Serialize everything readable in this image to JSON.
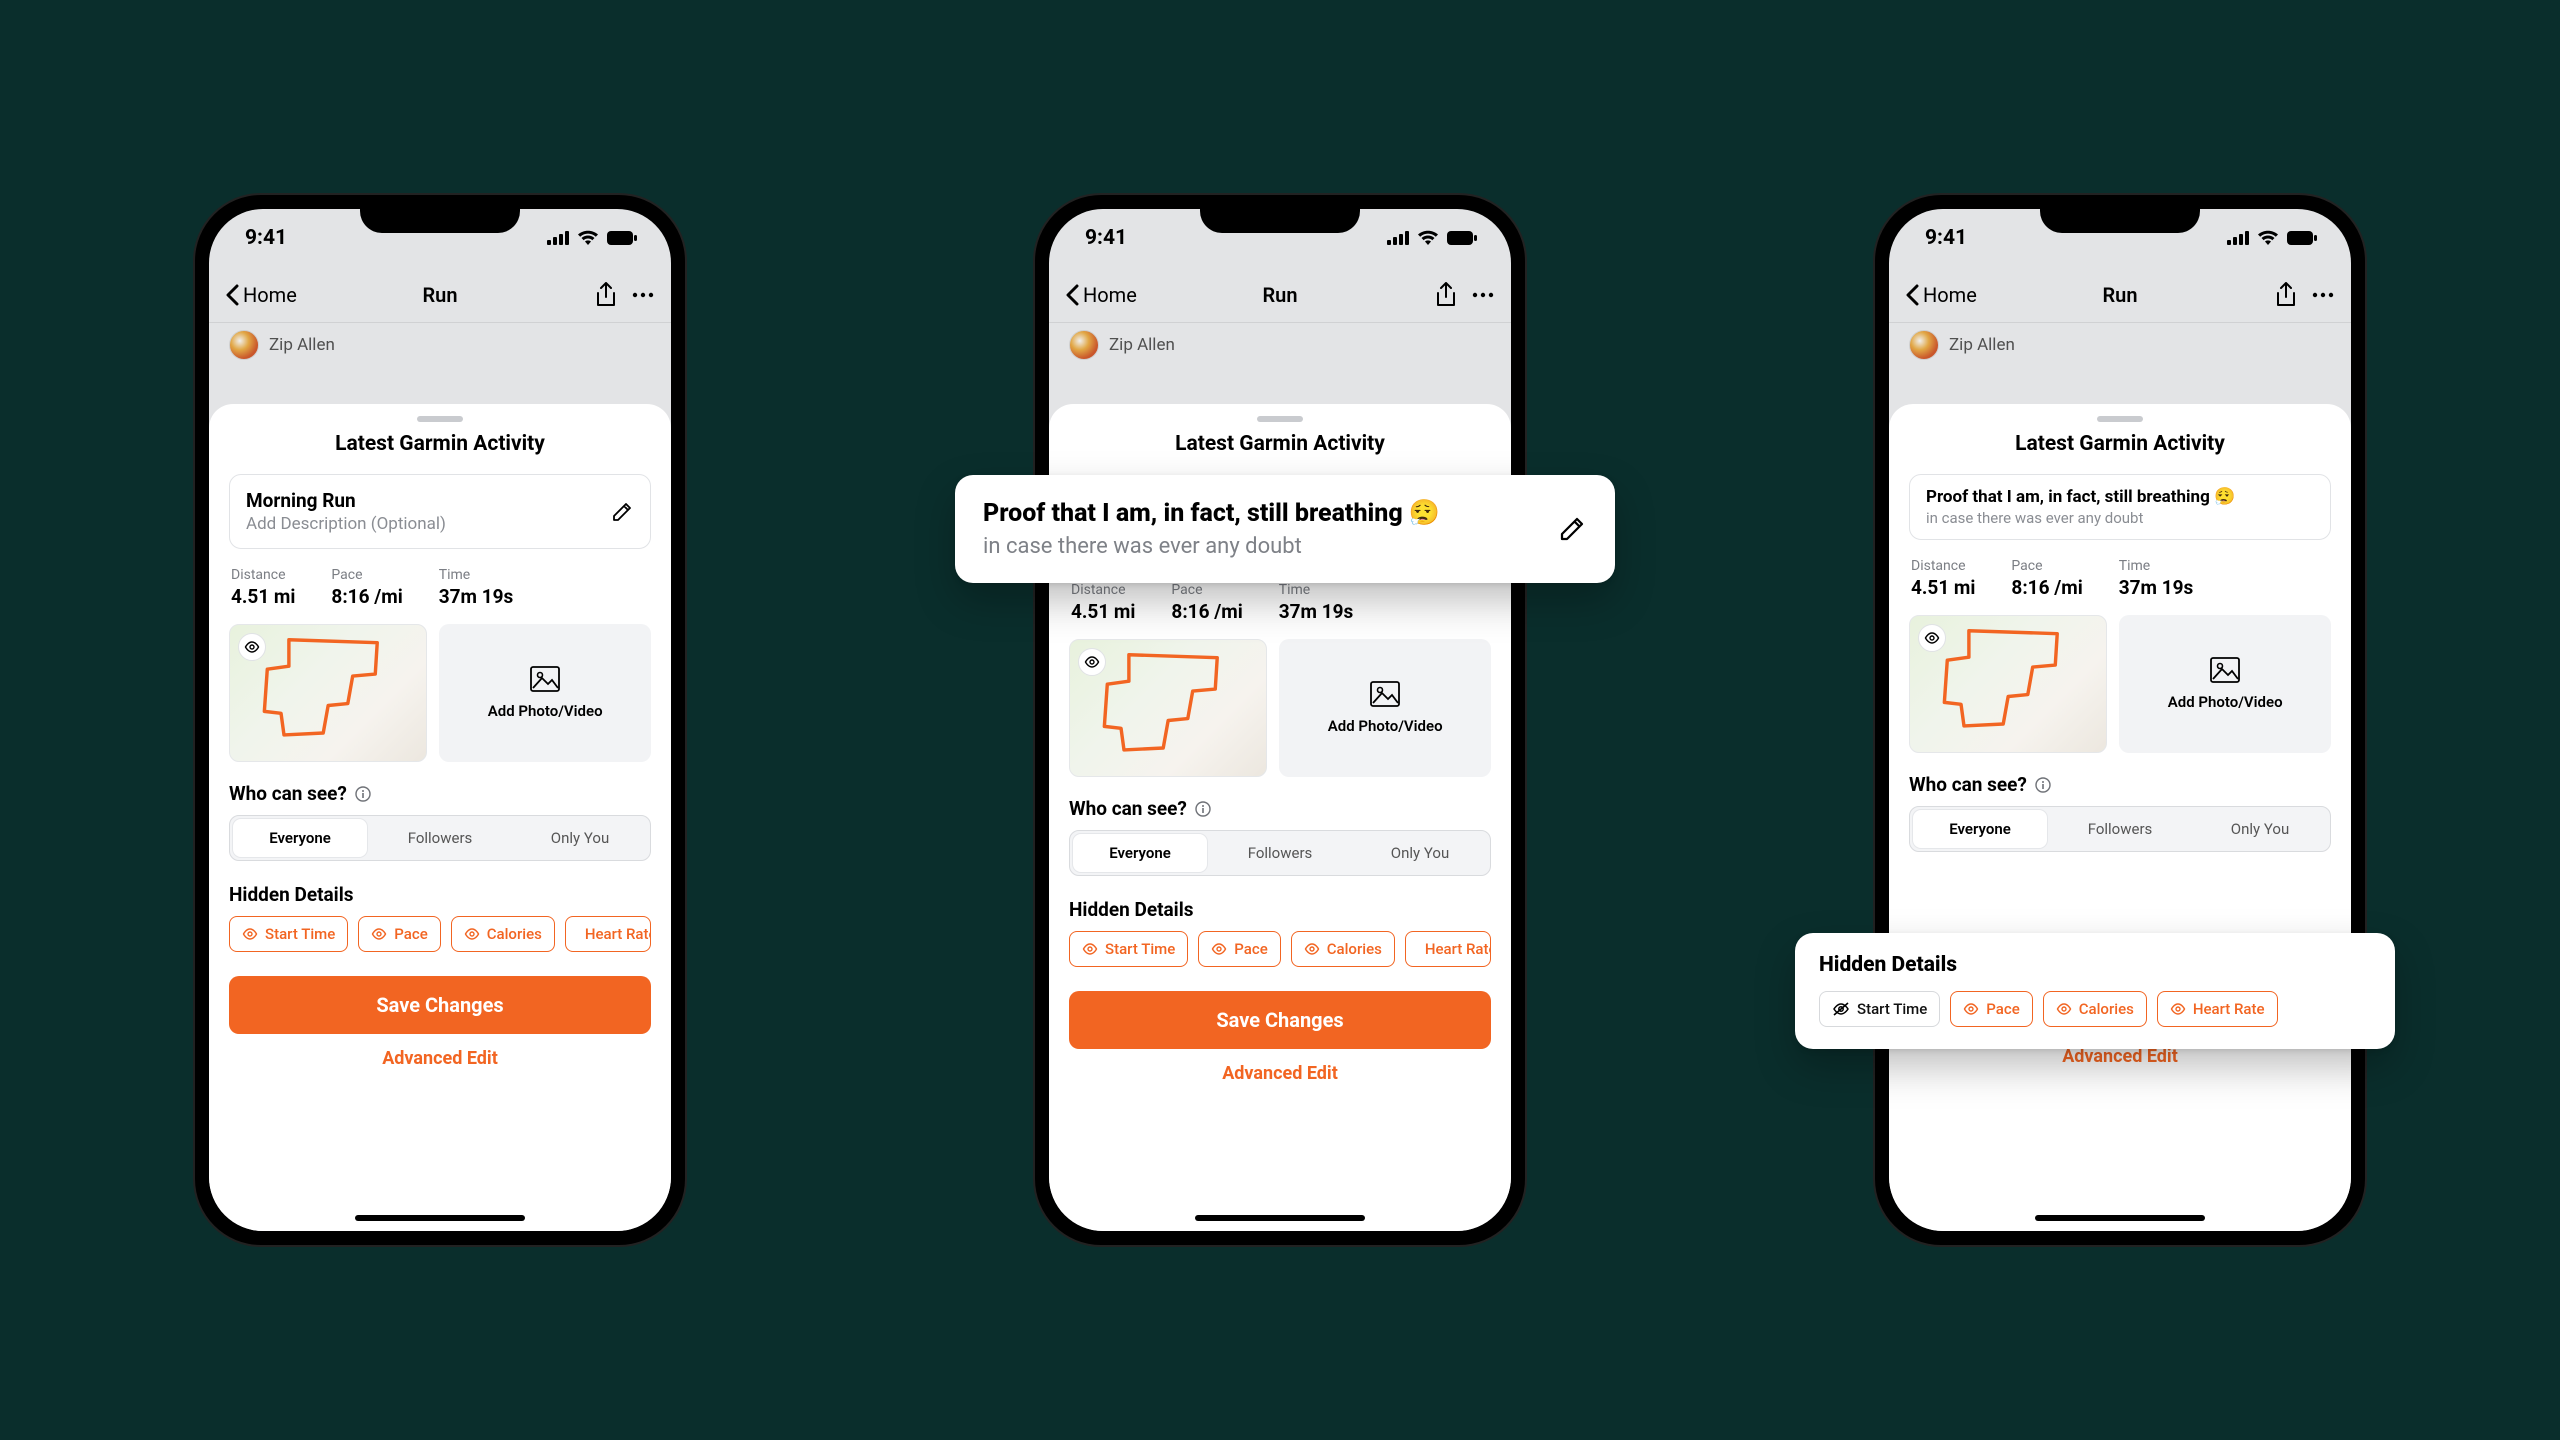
{
  "status": {
    "time": "9:41"
  },
  "nav": {
    "back": "Home",
    "title": "Run"
  },
  "user": {
    "name": "Zip Allen"
  },
  "sheet": {
    "title": "Latest Garmin Activity",
    "activity_title_default": "Morning Run",
    "activity_desc_placeholder": "Add Description (Optional)",
    "activity_title_filled": "Proof that I am, in fact, still breathing 😮‍💨",
    "activity_desc_filled": "in case there was ever any doubt",
    "stats": {
      "distance_label": "Distance",
      "distance": "4.51 mi",
      "pace_label": "Pace",
      "pace": "8:16 /mi",
      "time_label": "Time",
      "time": "37m 19s"
    },
    "add_media": "Add Photo/Video",
    "who_label": "Who can see?",
    "seg": [
      "Everyone",
      "Followers",
      "Only You"
    ],
    "hidden_label": "Hidden Details",
    "chips": [
      "Start Time",
      "Pace",
      "Calories",
      "Heart Rate"
    ],
    "save": "Save Changes",
    "advanced": "Advanced Edit"
  }
}
